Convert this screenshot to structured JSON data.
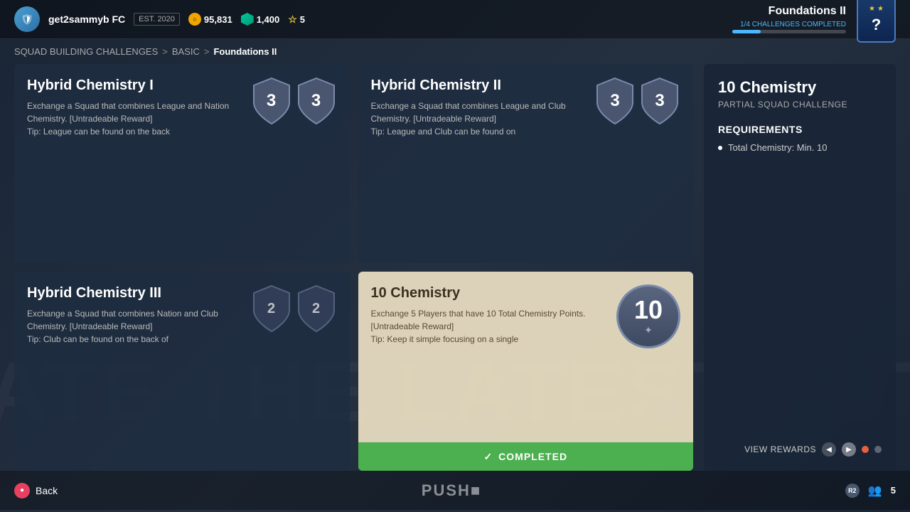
{
  "header": {
    "club_logo_text": "⚽",
    "club_name": "get2sammyb FC",
    "est_label": "EST. 2020",
    "coins": "95,831",
    "points": "1,400",
    "stars": "5",
    "foundations_title": "Foundations II",
    "progress_label": "1/4 CHALLENGES COMPLETED",
    "help_stars": [
      "★",
      "★"
    ],
    "help_q": "?"
  },
  "breadcrumb": {
    "items": [
      "SQUAD BUILDING CHALLENGES",
      "BASIC",
      "Foundations II"
    ],
    "arrow": ">"
  },
  "challenges": [
    {
      "id": "hybrid-chem-1",
      "title": "Hybrid Chemistry I",
      "description": "Exchange a Squad that combines League and Nation Chemistry. [Untradeable Reward]",
      "tip": "Tip: League can be found on the back",
      "badges": [
        {
          "number": "3",
          "stars": 1
        },
        {
          "number": "3",
          "stars": 1
        }
      ],
      "selected": false,
      "completed": false
    },
    {
      "id": "hybrid-chem-2",
      "title": "Hybrid Chemistry II",
      "description": "Exchange a Squad that combines League and Club Chemistry. [Untradeable Reward]",
      "tip": "Tip: League and Club can be found on",
      "badges": [
        {
          "number": "3",
          "stars": 1
        },
        {
          "number": "3",
          "stars": 1
        }
      ],
      "selected": false,
      "completed": false
    },
    {
      "id": "hybrid-chem-3",
      "title": "Hybrid Chemistry III",
      "description": "Exchange a Squad that combines Nation and Club Chemistry. [Untradeable Reward]",
      "tip": "Tip: Club can be found on the back of",
      "badges": [
        {
          "number": "2",
          "stars": 0
        },
        {
          "number": "2",
          "stars": 0
        }
      ],
      "selected": false,
      "completed": false
    },
    {
      "id": "10-chemistry",
      "title": "10 Chemistry",
      "description": "Exchange 5 Players that have 10 Total Chemistry Points. [Untradeable Reward]",
      "tip": "Tip: Keep it simple focusing on a single",
      "badge_number": "10",
      "selected": true,
      "completed": true,
      "completed_label": "COMPLETED"
    }
  ],
  "right_panel": {
    "title": "10 Chemistry",
    "subtitle": "PARTIAL SQUAD CHALLENGE",
    "requirements_title": "REQUIREMENTS",
    "requirements": [
      "Total Chemistry: Min. 10"
    ],
    "view_rewards_label": "VIEW REWARDS"
  },
  "footer": {
    "back_label": "Back",
    "back_circle": "●",
    "push_logo": "PUSH■",
    "r2_label": "R2",
    "people_count": "5"
  }
}
